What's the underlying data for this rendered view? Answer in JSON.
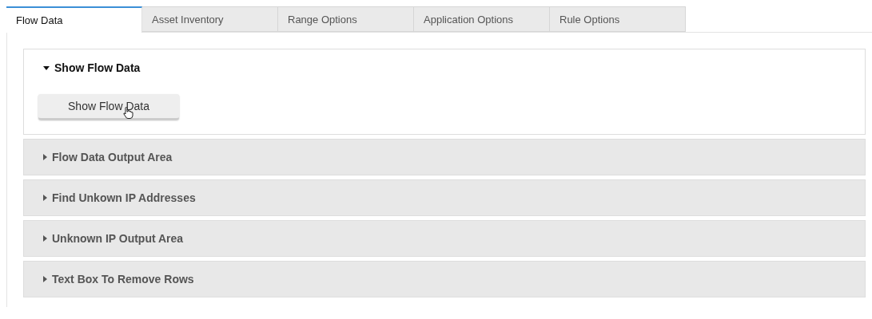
{
  "tabs": [
    {
      "label": "Flow Data",
      "selected": true
    },
    {
      "label": "Asset Inventory",
      "selected": false
    },
    {
      "label": "Range Options",
      "selected": false
    },
    {
      "label": "Application Options",
      "selected": false
    },
    {
      "label": "Rule Options",
      "selected": false
    }
  ],
  "sections": [
    {
      "title": "Show Flow Data",
      "expanded": true,
      "button": "Show Flow Data"
    },
    {
      "title": "Flow Data Output Area",
      "expanded": false
    },
    {
      "title": "Find Unkown IP Addresses",
      "expanded": false
    },
    {
      "title": "Unknown IP Output Area",
      "expanded": false
    },
    {
      "title": "Text Box To Remove Rows",
      "expanded": false
    }
  ]
}
